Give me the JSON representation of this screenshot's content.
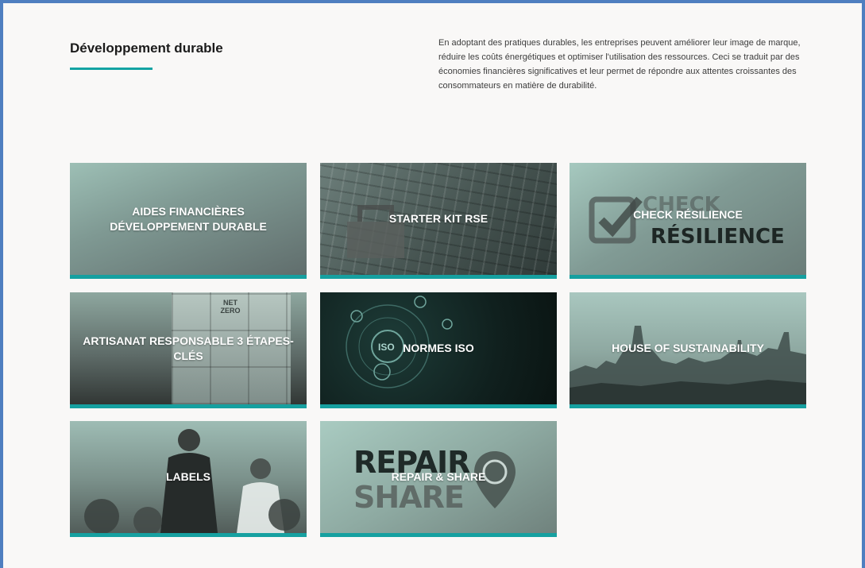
{
  "section": {
    "title": "Développement durable",
    "intro": "En adoptant des pratiques durables, les entreprises peuvent améliorer leur image de marque, réduire les coûts énergétiques et optimiser l'utilisation des ressources. Ceci se traduit par des économies financières significatives et leur permet de répondre aux attentes croissantes des consommateurs en matière de durabilité."
  },
  "cards": [
    {
      "label": "AIDES FINANCIÈRES DÉVELOPPEMENT DURABLE"
    },
    {
      "label": "STARTER KIT RSE"
    },
    {
      "label": "CHECK RÉSILIENCE",
      "image_text_top": "CHECK",
      "image_text_bottom": "RÉSILIENCE"
    },
    {
      "label": "ARTISANAT RESPONSABLE 3 ÉTAPES-CLÉS",
      "image_text": "NET ZERO"
    },
    {
      "label": "NORMES ISO",
      "image_text": "ISO"
    },
    {
      "label": "HOUSE OF SUSTAINABILITY"
    },
    {
      "label": "LABELS"
    },
    {
      "label": "REPAIR & SHARE",
      "image_text_top": "REPAIR",
      "image_text_bottom": "SHARE"
    }
  ],
  "colors": {
    "accent": "#16a0a0",
    "frame_border": "#4f7fc0",
    "page_background": "#f9f8f7"
  }
}
